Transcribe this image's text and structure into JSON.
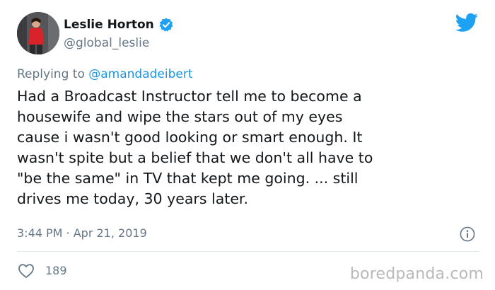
{
  "author": {
    "name": "Leslie Horton",
    "handle": "@global_leslie",
    "avatar_icon": "profile-photo",
    "verified_icon": "verified-badge-icon",
    "verified_color": "#1da1f2"
  },
  "header": {
    "brand_icon": "twitter-bird-icon",
    "brand_color": "#1da1f2"
  },
  "reply": {
    "prefix": "Replying to ",
    "mention": "@amandadeibert"
  },
  "tweet": {
    "text": "Had a Broadcast Instructor tell me to become a\nhousewife and wipe the stars out of my eyes\ncause i wasn't good looking or smart enough.  It\nwasn't spite but a belief that we don't all have to\n\"be the same\" in TV that kept me going. ... still\ndrives me today, 30 years later.",
    "timestamp": "3:44 PM · Apr 21, 2019",
    "info_icon": "info-icon"
  },
  "actions": {
    "like_icon": "heart-icon",
    "like_count": "189"
  },
  "watermark": "boredpanda.com",
  "colors": {
    "text": "#14171a",
    "muted": "#657786",
    "link": "#1b95e0",
    "divider": "#e1e8ed",
    "watermark": "#b9b9b9"
  }
}
